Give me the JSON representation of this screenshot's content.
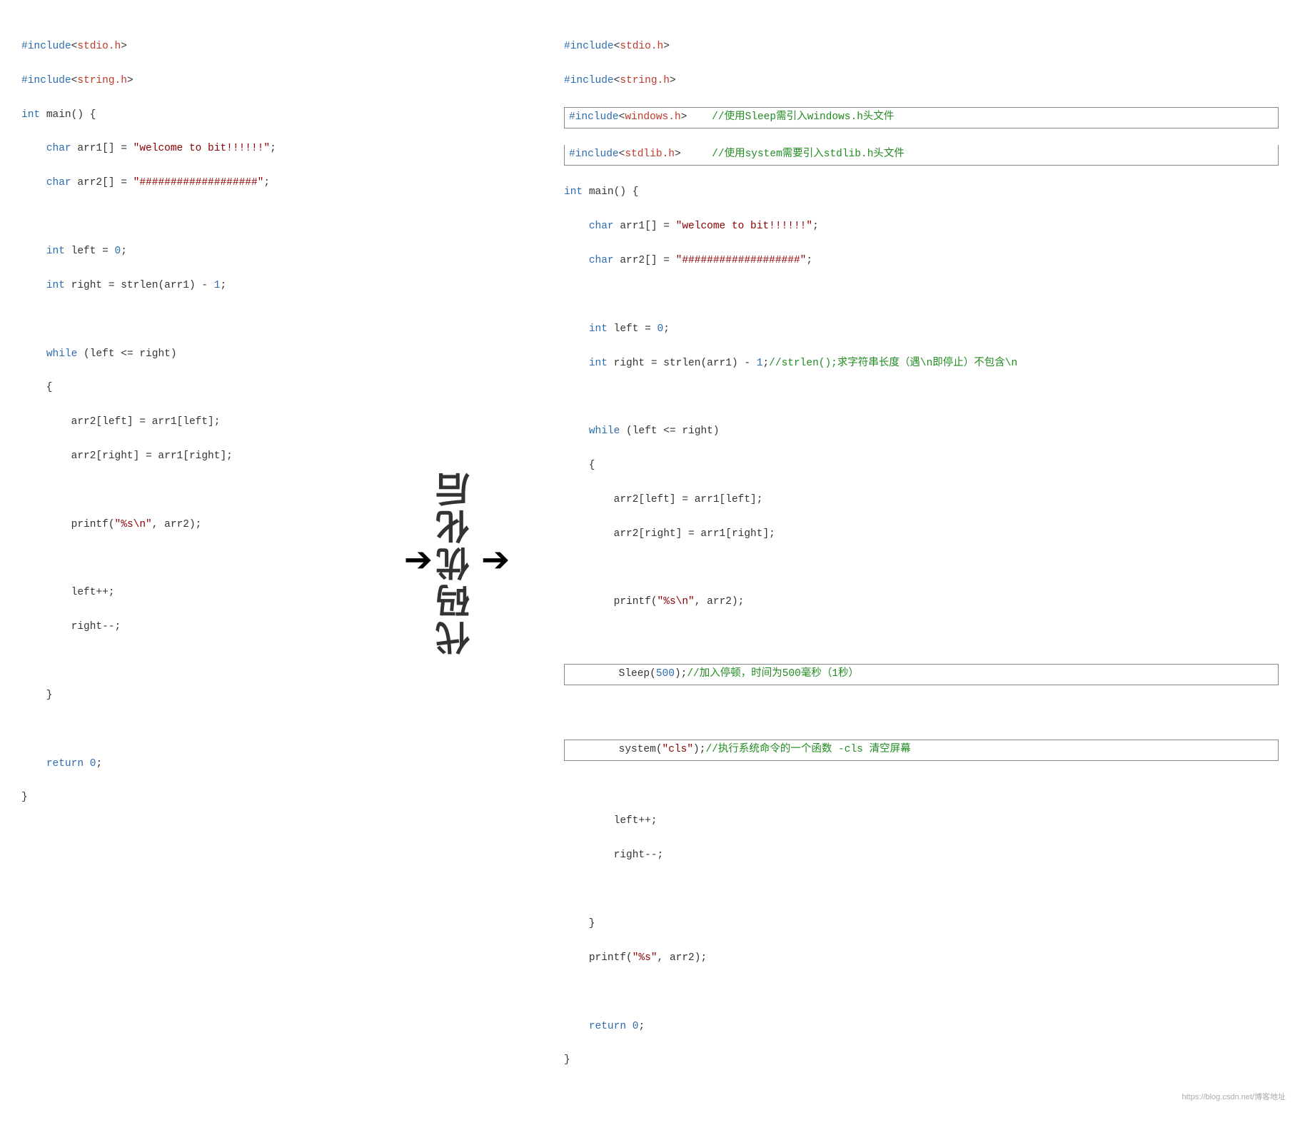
{
  "left": {
    "lines": [
      {
        "id": "l1",
        "text": "#include<stdio.h>"
      },
      {
        "id": "l2",
        "text": "#include<string.h>"
      },
      {
        "id": "l3",
        "text": "int main() {"
      },
      {
        "id": "l4",
        "text": "    char arr1[] = \"welcome to bit!!!!!!\";"
      },
      {
        "id": "l5",
        "text": "    char arr2[] = \"###################\";"
      },
      {
        "id": "l6",
        "text": ""
      },
      {
        "id": "l7",
        "text": "    int left = 0;"
      },
      {
        "id": "l8",
        "text": "    int right = strlen(arr1) - 1;"
      },
      {
        "id": "l9",
        "text": ""
      },
      {
        "id": "l10",
        "text": "    while (left <= right)"
      },
      {
        "id": "l11",
        "text": "    {"
      },
      {
        "id": "l12",
        "text": "        arr2[left] = arr1[left];"
      },
      {
        "id": "l13",
        "text": "        arr2[right] = arr1[right];"
      },
      {
        "id": "l14",
        "text": ""
      },
      {
        "id": "l15",
        "text": "        printf(\"%s\\n\", arr2);"
      },
      {
        "id": "l16",
        "text": ""
      },
      {
        "id": "l17",
        "text": "        left++;"
      },
      {
        "id": "l18",
        "text": "        right--;"
      },
      {
        "id": "l19",
        "text": ""
      },
      {
        "id": "l20",
        "text": "    }"
      },
      {
        "id": "l21",
        "text": ""
      },
      {
        "id": "l22",
        "text": "    return 0;"
      },
      {
        "id": "l23",
        "text": "}"
      }
    ]
  },
  "middle": {
    "label": "代码优化后",
    "arrow_left": "→",
    "arrow_right": "→"
  },
  "right": {
    "watermark": "https://blog.csdn.net/博客地址"
  }
}
